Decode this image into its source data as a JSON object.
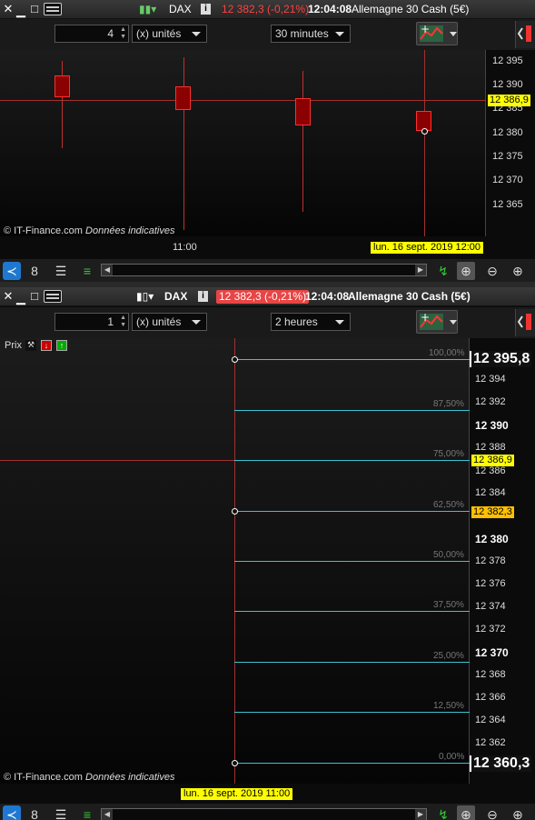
{
  "window1": {
    "instrument": "DAX",
    "price": "12 382,3 (-0,21%)",
    "time": "12:04:08",
    "description": "Allemagne 30 Cash (5€)",
    "units_value": "4",
    "units_label": "(x) unités",
    "timeframe": "30 minutes",
    "y_labels": [
      "12 395",
      "12 390",
      "12 385",
      "12 380",
      "12 375",
      "12 370",
      "12 365"
    ],
    "current_price_tag": "12 386,9",
    "x_label": "11:00",
    "date_tag": "lun. 16 sept. 2019 12:00",
    "watermark_source": "© IT-Finance.com",
    "watermark_note": "Données indicatives"
  },
  "window2": {
    "instrument": "DAX",
    "price": "12 382,3 (-0,21%)",
    "time": "12:04:08",
    "description": "Allemagne 30 Cash (5€)",
    "units_value": "1",
    "units_label": "(x) unités",
    "timeframe": "2 heures",
    "prix_label": "Prix",
    "y_labels": [
      {
        "t": "12 394",
        "bold": false
      },
      {
        "t": "12 392",
        "bold": false
      },
      {
        "t": "12 390",
        "bold": true
      },
      {
        "t": "12 388",
        "bold": false
      },
      {
        "t": "12 386",
        "bold": false
      },
      {
        "t": "12 384",
        "bold": false
      },
      {
        "t": "12 380",
        "bold": true
      },
      {
        "t": "12 378",
        "bold": false
      },
      {
        "t": "12 376",
        "bold": false
      },
      {
        "t": "12 374",
        "bold": false
      },
      {
        "t": "12 372",
        "bold": false
      },
      {
        "t": "12 370",
        "bold": true
      },
      {
        "t": "12 368",
        "bold": false
      },
      {
        "t": "12 366",
        "bold": false
      },
      {
        "t": "12 364",
        "bold": false
      },
      {
        "t": "12 362",
        "bold": false
      }
    ],
    "fib_levels": [
      "100,00%",
      "87,50%",
      "75,00%",
      "62,50%",
      "50,00%",
      "37,50%",
      "25,00%",
      "12,50%",
      "0,00%"
    ],
    "high_tag": "12 395,8",
    "low_tag": "12 360,3",
    "current_price_tag": "12 386,9",
    "last_price_tag": "12 382,3",
    "date_tag": "lun. 16 sept. 2019 11:00",
    "watermark_source": "© IT-Finance.com",
    "watermark_note": "Données indicatives"
  },
  "colors": {
    "candle_body": "#8b0000",
    "fib_line": "#40c0d0",
    "price_tag": "#ffff00",
    "last_tag": "#ffc000",
    "price_negative": "#ff4040"
  },
  "icons": {
    "close": "close-icon",
    "minimize": "minimize-icon",
    "maximize": "maximize-icon",
    "keyboard": "keyboard-icon",
    "candle": "candlestick-icon",
    "info": "info-icon",
    "share": "share-icon",
    "zoom_in": "zoom-in-icon",
    "zoom_out": "zoom-out-icon"
  }
}
